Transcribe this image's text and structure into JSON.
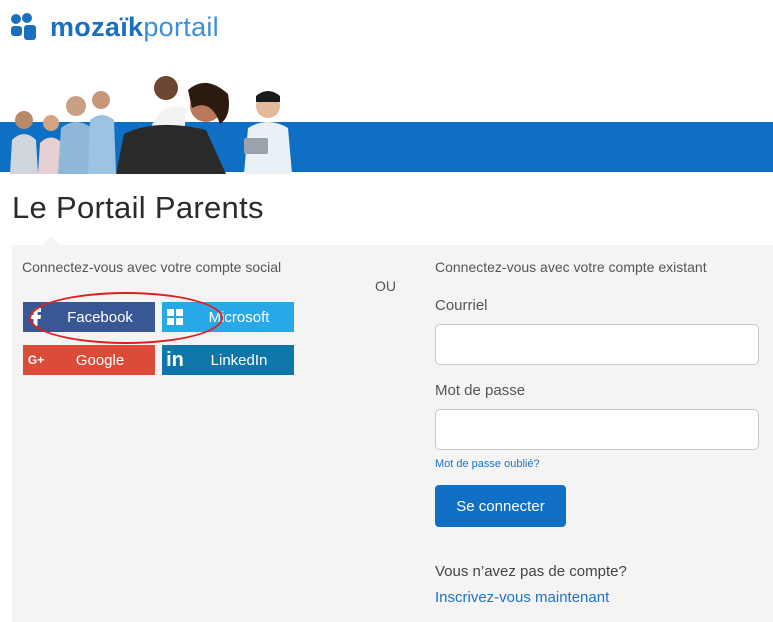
{
  "brand": {
    "name_bold": "mozaïk",
    "name_light": "portail",
    "color": "#1a6fbf"
  },
  "page_title": "Le Portail Parents",
  "social": {
    "heading": "Connectez-vous avec votre compte social",
    "buttons": [
      {
        "label": "Facebook",
        "icon": "facebook-icon",
        "color": "#3a5795"
      },
      {
        "label": "Microsoft",
        "icon": "windows-icon",
        "color": "#29a8e8"
      },
      {
        "label": "Google",
        "icon": "google-plus-icon",
        "color": "#dc4a38"
      },
      {
        "label": "LinkedIn",
        "icon": "linkedin-icon",
        "color": "#0e76a8"
      }
    ]
  },
  "separator": "OU",
  "login": {
    "heading": "Connectez-vous avec votre compte existant",
    "email_label": "Courriel",
    "email_value": "",
    "password_label": "Mot de passe",
    "password_value": "",
    "forgot_link": "Mot de passe oublié?",
    "submit_label": "Se connecter",
    "no_account_text": "Vous n’avez pas de compte?",
    "register_link": "Inscrivez-vous maintenant"
  },
  "colors": {
    "accent": "#0f6fc4",
    "annotation": "#e02020",
    "panel_bg": "#f4f4f4"
  }
}
